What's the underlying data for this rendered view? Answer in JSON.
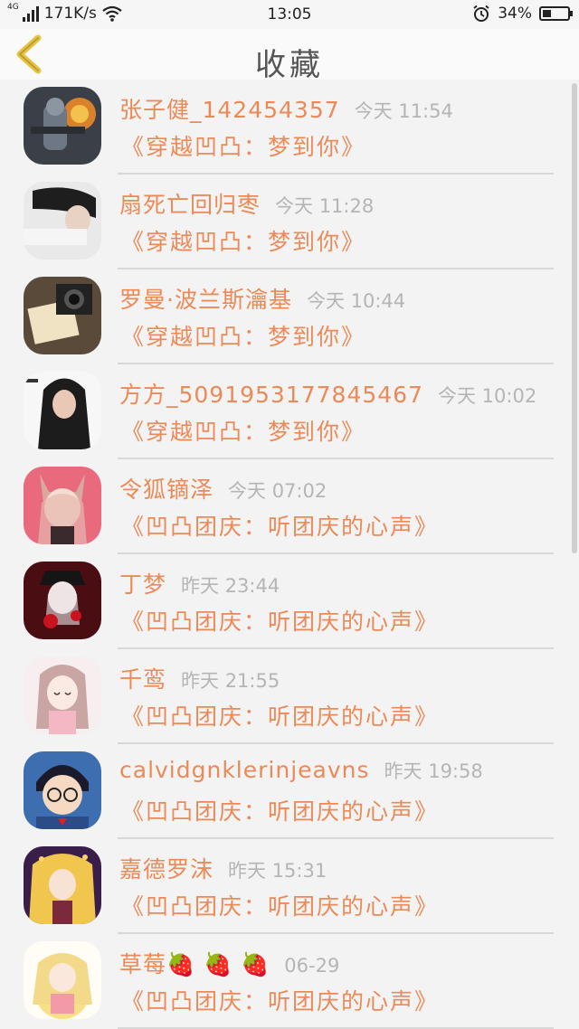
{
  "status_bar": {
    "network_type": "4G",
    "speed": "171K/s",
    "time": "13:05",
    "battery_percent": "34%",
    "battery_level": 0.34
  },
  "header": {
    "title": "收藏"
  },
  "colors": {
    "accent": "#ec8a57",
    "time_gray": "#b5b5b5",
    "back_arrow": "#e8c341"
  },
  "items": [
    {
      "name": "张子健_142454357",
      "time": "今天 11:54",
      "message": "《穿越凹凸：梦到你》",
      "avatar": "game-soldier-avatar"
    },
    {
      "name": "扇死亡回归枣",
      "time": "今天 11:28",
      "message": "《穿越凹凸：梦到你》",
      "avatar": "person-avatar"
    },
    {
      "name": "罗曼·波兰斯瀹基",
      "time": "今天 10:44",
      "message": "《穿越凹凸：梦到你》",
      "avatar": "camera-photo-avatar"
    },
    {
      "name": "方方_5091953177845467",
      "time": "今天 10:02",
      "message": "《穿越凹凸：梦到你》",
      "avatar": "woman-photo-avatar"
    },
    {
      "name": "令狐镝泽",
      "time": "今天 07:02",
      "message": "《凹凸团庆：听团庆的心声》",
      "avatar": "anime-fox-girl-avatar"
    },
    {
      "name": "丁梦",
      "time": "昨天 23:44",
      "message": "《凹凸团庆：听团庆的心声》",
      "avatar": "anime-dark-girl-avatar"
    },
    {
      "name": "千鸾",
      "time": "昨天 21:55",
      "message": "《凹凸团庆：听团庆的心声》",
      "avatar": "anime-pink-girl-avatar"
    },
    {
      "name": "calvidgnklerinjeavns",
      "time": "昨天 19:58",
      "message": "《凹凸团庆：听团庆的心声》",
      "avatar": "anime-glasses-boy-avatar"
    },
    {
      "name": "嘉德罗沫",
      "time": "昨天 15:31",
      "message": "《凹凸团庆：听团庆的心声》",
      "avatar": "anime-blonde-girl-avatar"
    },
    {
      "name": "草莓🍓 🍓 🍓",
      "time": "06-29",
      "message": "《凹凸团庆：听团庆的心声》",
      "avatar": "anime-yellow-girl-avatar"
    }
  ]
}
